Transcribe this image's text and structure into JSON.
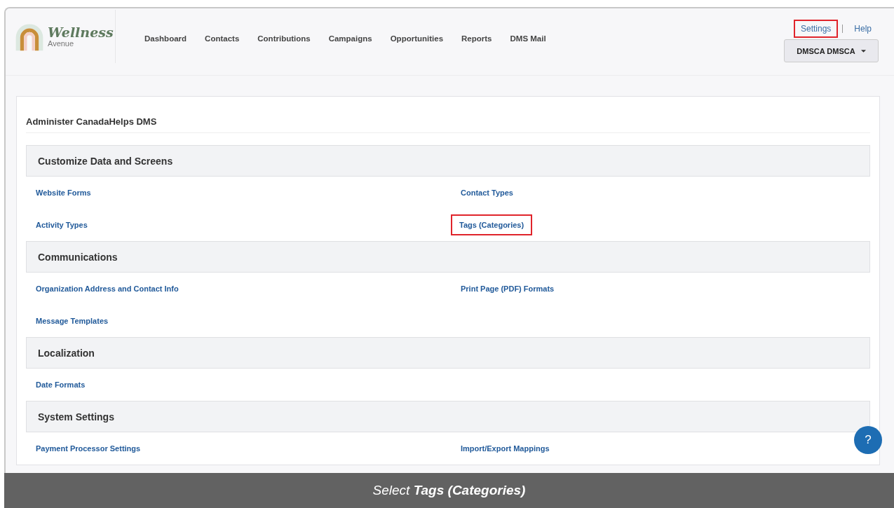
{
  "header": {
    "logo": {
      "title": "Wellness",
      "subtitle": "Avenue"
    },
    "nav": [
      "Dashboard",
      "Contacts",
      "Contributions",
      "Campaigns",
      "Opportunities",
      "Reports",
      "DMS Mail"
    ],
    "top_links": [
      {
        "label": "Settings",
        "highlighted": true
      },
      {
        "label": "Help",
        "highlighted": false
      }
    ],
    "user_menu": {
      "label": "DMSCA DMSCA"
    }
  },
  "page_title": "Administer CanadaHelps DMS",
  "sections": [
    {
      "title": "Customize Data and Screens",
      "links": [
        {
          "label": "Website Forms",
          "highlighted": false
        },
        {
          "label": "Contact Types",
          "highlighted": false
        },
        {
          "label": "Activity Types",
          "highlighted": false
        },
        {
          "label": "Tags (Categories)",
          "highlighted": true
        }
      ]
    },
    {
      "title": "Communications",
      "links": [
        {
          "label": "Organization Address and Contact Info",
          "highlighted": false
        },
        {
          "label": "Print Page (PDF) Formats",
          "highlighted": false
        },
        {
          "label": "Message Templates",
          "highlighted": false
        }
      ]
    },
    {
      "title": "Localization",
      "links": [
        {
          "label": "Date Formats",
          "highlighted": false
        }
      ]
    },
    {
      "title": "System Settings",
      "links": [
        {
          "label": "Payment Processor Settings",
          "highlighted": false
        },
        {
          "label": "Import/Export Mappings",
          "highlighted": false
        }
      ]
    }
  ],
  "help_button": "?",
  "caption": "Select **Tags (Categories)**"
}
